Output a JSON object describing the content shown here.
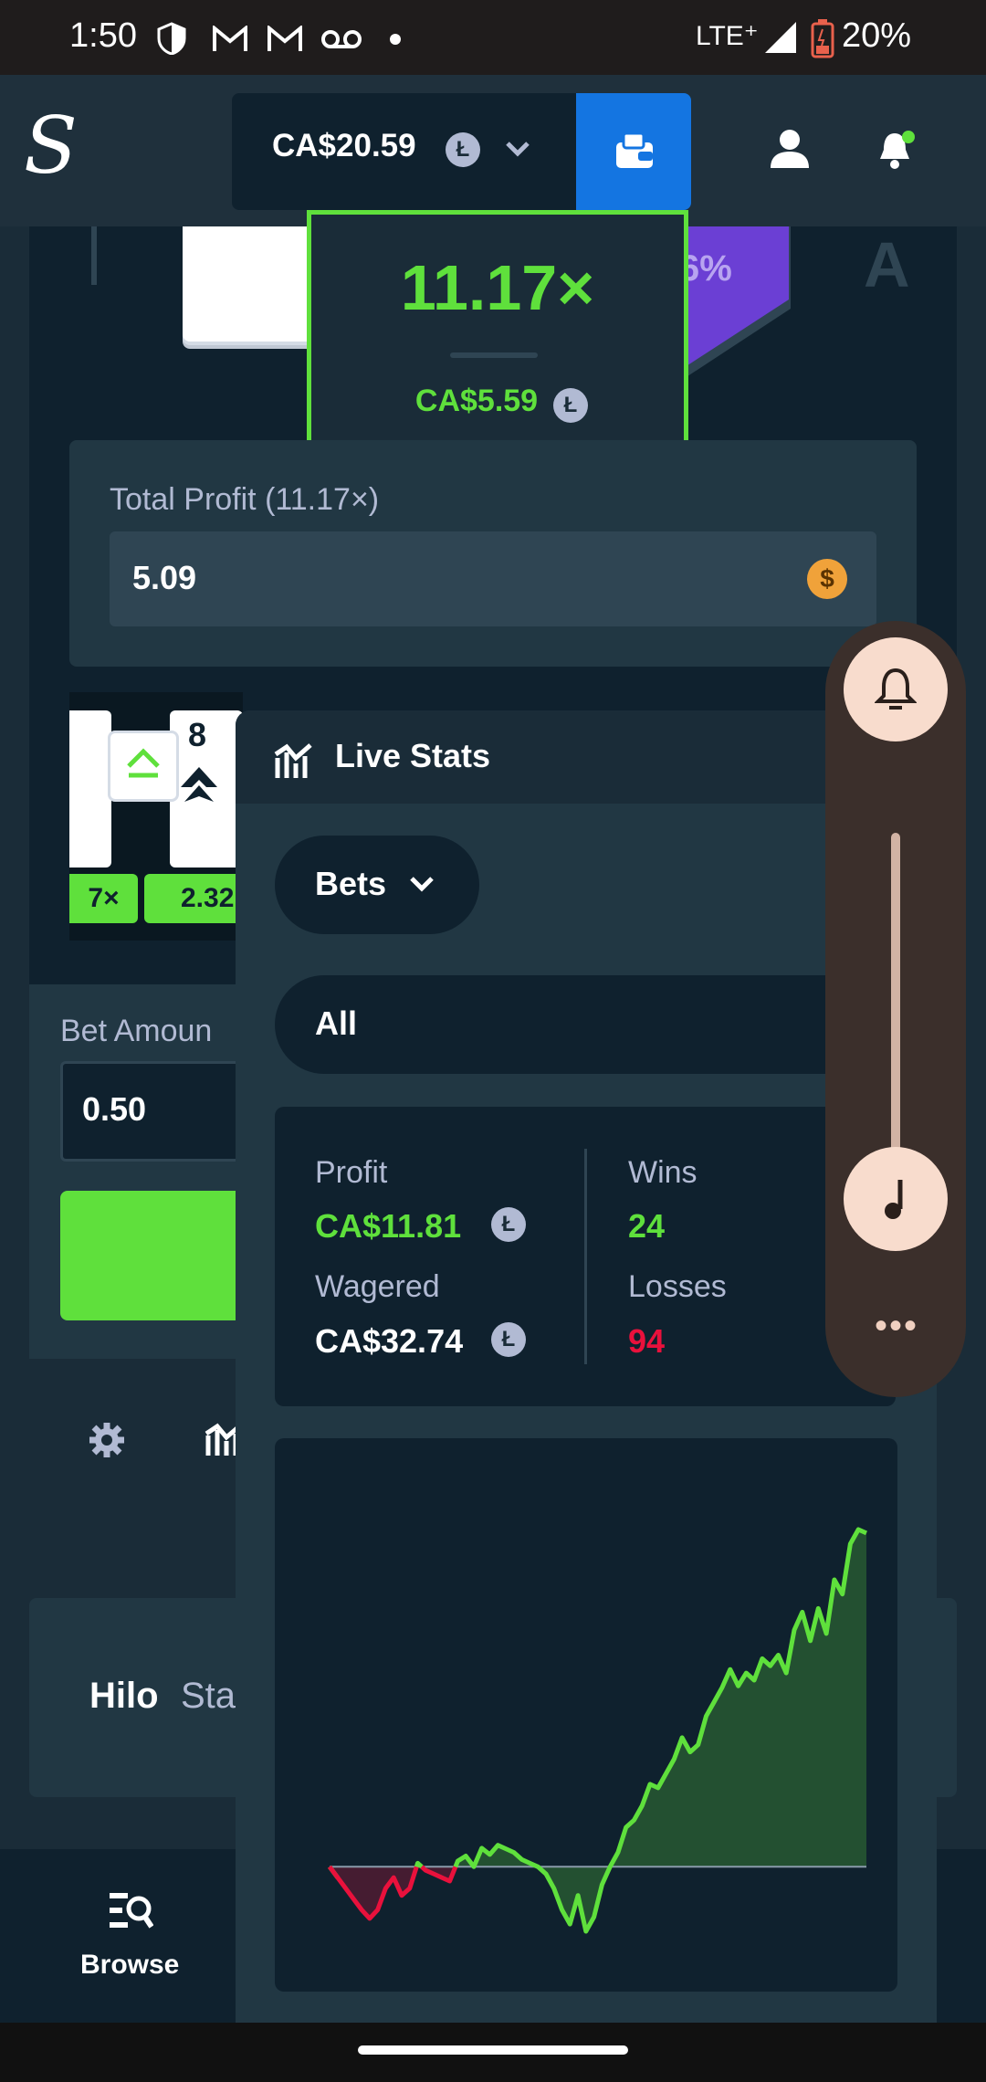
{
  "status_bar": {
    "time": "1:50",
    "network": "LTE⁺",
    "battery": "20%"
  },
  "header": {
    "logo": "S",
    "balance": "CA$20.59",
    "coin_symbol": "Ł"
  },
  "game": {
    "multiplier": "11.17×",
    "multiplier_payout": "CA$5.59",
    "side_percent": "6%",
    "side_card": "A",
    "total_profit_label": "Total Profit (11.17×)",
    "total_profit_value": "5.09",
    "currency_symbol": "$",
    "card_rank": "8",
    "card_tags": [
      "7×",
      "2.32"
    ],
    "bet_amount_label": "Bet Amoun",
    "bet_amount_value": "0.50",
    "game_title": "Hilo",
    "game_tab_partial": "Sta",
    "nav_browse": "Browse"
  },
  "live_stats": {
    "title": "Live Stats",
    "dropdown": "Bets",
    "filter": "All",
    "profit_label": "Profit",
    "profit_value": "CA$11.81",
    "wagered_label": "Wagered",
    "wagered_value": "CA$32.74",
    "wins_label": "Wins",
    "wins_value": "24",
    "losses_label": "Losses",
    "losses_value": "94",
    "colors": {
      "positive": "#5fe03c",
      "negative": "#e9113c"
    }
  },
  "chart_data": {
    "type": "area",
    "baseline": 0,
    "series": [
      {
        "values": [
          0,
          -1.5,
          -3,
          -4.5,
          -6,
          -7.2,
          -6,
          -3,
          -1.5,
          -4,
          -3,
          0.5,
          -0.5,
          -1,
          -1.5,
          -2,
          0.8,
          1.5,
          0,
          2.6,
          1.7,
          3,
          2.5,
          2,
          1,
          0.5,
          0,
          -1,
          -3,
          -6,
          -8,
          -4,
          -9,
          -7,
          -2.5,
          0,
          2,
          5.5,
          6.5,
          8.5,
          11.5,
          11,
          13,
          15,
          18,
          16,
          17,
          21,
          23,
          25,
          27.5,
          25.2,
          27,
          26,
          29,
          28,
          29.5,
          27,
          33,
          35.5,
          31.5,
          36,
          32.5,
          40,
          38,
          45,
          47,
          46.5
        ]
      }
    ],
    "grid": false
  }
}
